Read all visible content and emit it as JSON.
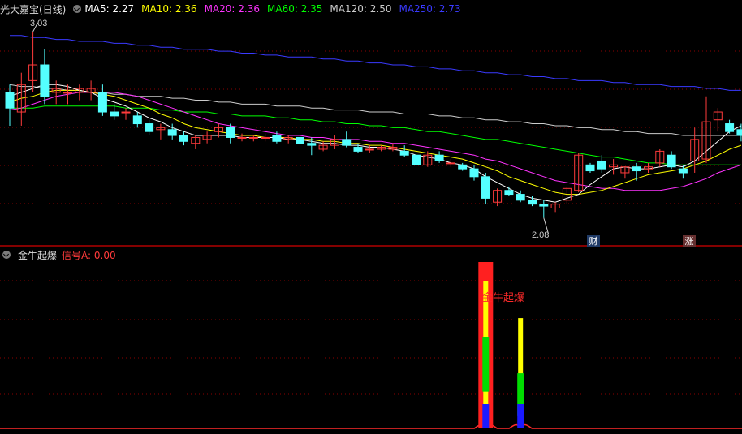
{
  "main_header": {
    "title": "光大嘉宝(日线)",
    "ma": [
      {
        "label": "MA5: 2.27",
        "color": "#ffffff"
      },
      {
        "label": "MA10: 2.36",
        "color": "#ffff00"
      },
      {
        "label": "MA20: 2.36",
        "color": "#ff33ff"
      },
      {
        "label": "MA60: 2.35",
        "color": "#00ff00"
      },
      {
        "label": "MA120: 2.50",
        "color": "#cccccc"
      },
      {
        "label": "MA250: 2.73",
        "color": "#3a3aff"
      }
    ]
  },
  "indicator_header": {
    "title": "金牛起爆",
    "signal_label": "信号A: 0.00"
  },
  "annotations": {
    "high_label": "3.03",
    "low_label": "2.08",
    "event_cai": "财",
    "event_zhang": "涨",
    "signal_text": "金牛起爆"
  },
  "colors": {
    "up": "#ff3b3b",
    "down": "#54ffff",
    "grid": "#8b0000",
    "ma5": "#ffffff",
    "ma10": "#ffff00",
    "ma20": "#ff33ff",
    "ma60": "#00ff00",
    "ma120": "#cccccc",
    "ma250": "#3a3aff"
  },
  "chart_data": {
    "type": "candlestick",
    "y_range": [
      1.95,
      3.1
    ],
    "candles": [
      [
        2.72,
        2.76,
        2.55,
        2.64
      ],
      [
        2.62,
        2.82,
        2.55,
        2.76
      ],
      [
        2.78,
        3.03,
        2.72,
        2.86
      ],
      [
        2.86,
        2.94,
        2.66,
        2.7
      ],
      [
        2.72,
        2.78,
        2.66,
        2.74
      ],
      [
        2.72,
        2.76,
        2.66,
        2.72
      ],
      [
        2.72,
        2.76,
        2.68,
        2.74
      ],
      [
        2.72,
        2.78,
        2.68,
        2.74
      ],
      [
        2.72,
        2.76,
        2.6,
        2.62
      ],
      [
        2.62,
        2.66,
        2.58,
        2.6
      ],
      [
        2.62,
        2.64,
        2.58,
        2.62
      ],
      [
        2.6,
        2.62,
        2.54,
        2.56
      ],
      [
        2.56,
        2.58,
        2.5,
        2.52
      ],
      [
        2.53,
        2.56,
        2.48,
        2.54
      ],
      [
        2.53,
        2.56,
        2.48,
        2.5
      ],
      [
        2.5,
        2.52,
        2.45,
        2.47
      ],
      [
        2.46,
        2.5,
        2.43,
        2.49
      ],
      [
        2.48,
        2.52,
        2.46,
        2.5
      ],
      [
        2.52,
        2.56,
        2.49,
        2.54
      ],
      [
        2.54,
        2.56,
        2.46,
        2.49
      ],
      [
        2.49,
        2.51,
        2.47,
        2.49
      ],
      [
        2.49,
        2.5,
        2.47,
        2.49
      ],
      [
        2.49,
        2.51,
        2.47,
        2.49
      ],
      [
        2.5,
        2.52,
        2.46,
        2.47
      ],
      [
        2.48,
        2.5,
        2.46,
        2.49
      ],
      [
        2.49,
        2.51,
        2.44,
        2.46
      ],
      [
        2.46,
        2.49,
        2.4,
        2.45
      ],
      [
        2.43,
        2.47,
        2.42,
        2.45
      ],
      [
        2.45,
        2.5,
        2.43,
        2.48
      ],
      [
        2.48,
        2.52,
        2.44,
        2.45
      ],
      [
        2.44,
        2.46,
        2.41,
        2.42
      ],
      [
        2.43,
        2.45,
        2.41,
        2.43
      ],
      [
        2.43,
        2.45,
        2.42,
        2.44
      ],
      [
        2.43,
        2.46,
        2.42,
        2.44
      ],
      [
        2.42,
        2.45,
        2.39,
        2.4
      ],
      [
        2.4,
        2.42,
        2.34,
        2.35
      ],
      [
        2.35,
        2.42,
        2.34,
        2.4
      ],
      [
        2.4,
        2.42,
        2.36,
        2.37
      ],
      [
        2.36,
        2.38,
        2.34,
        2.36
      ],
      [
        2.35,
        2.36,
        2.32,
        2.33
      ],
      [
        2.33,
        2.35,
        2.27,
        2.29
      ],
      [
        2.29,
        2.31,
        2.15,
        2.18
      ],
      [
        2.16,
        2.23,
        2.14,
        2.22
      ],
      [
        2.22,
        2.24,
        2.19,
        2.2
      ],
      [
        2.2,
        2.22,
        2.16,
        2.17
      ],
      [
        2.17,
        2.19,
        2.14,
        2.15
      ],
      [
        2.15,
        2.17,
        2.08,
        2.14
      ],
      [
        2.13,
        2.16,
        2.11,
        2.15
      ],
      [
        2.17,
        2.24,
        2.15,
        2.23
      ],
      [
        2.22,
        2.41,
        2.21,
        2.4
      ],
      [
        2.35,
        2.36,
        2.31,
        2.32
      ],
      [
        2.37,
        2.4,
        2.31,
        2.33
      ],
      [
        2.34,
        2.38,
        2.3,
        2.35
      ],
      [
        2.31,
        2.34,
        2.28,
        2.34
      ],
      [
        2.34,
        2.36,
        2.27,
        2.32
      ],
      [
        2.33,
        2.36,
        2.31,
        2.34
      ],
      [
        2.36,
        2.43,
        2.34,
        2.42
      ],
      [
        2.4,
        2.42,
        2.33,
        2.34
      ],
      [
        2.33,
        2.35,
        2.28,
        2.31
      ],
      [
        2.37,
        2.54,
        2.31,
        2.48
      ],
      [
        2.38,
        2.7,
        2.36,
        2.57
      ],
      [
        2.58,
        2.64,
        2.52,
        2.62
      ],
      [
        2.56,
        2.58,
        2.51,
        2.52
      ],
      [
        2.53,
        2.56,
        2.47,
        2.5
      ]
    ],
    "ma5": [
      2.7,
      2.72,
      2.74,
      2.76,
      2.76,
      2.75,
      2.73,
      2.72,
      2.69,
      2.67,
      2.65,
      2.62,
      2.59,
      2.57,
      2.54,
      2.52,
      2.5,
      2.5,
      2.5,
      2.5,
      2.49,
      2.49,
      2.49,
      2.49,
      2.48,
      2.48,
      2.47,
      2.46,
      2.46,
      2.45,
      2.45,
      2.44,
      2.44,
      2.43,
      2.42,
      2.4,
      2.39,
      2.38,
      2.36,
      2.35,
      2.33,
      2.29,
      2.26,
      2.23,
      2.2,
      2.18,
      2.17,
      2.16,
      2.18,
      2.2,
      2.25,
      2.29,
      2.33,
      2.34,
      2.33,
      2.33,
      2.34,
      2.35,
      2.34,
      2.37,
      2.42,
      2.47,
      2.52,
      2.55
    ],
    "ma10": [
      2.67,
      2.69,
      2.7,
      2.72,
      2.73,
      2.73,
      2.73,
      2.72,
      2.71,
      2.7,
      2.68,
      2.66,
      2.64,
      2.61,
      2.59,
      2.56,
      2.54,
      2.53,
      2.52,
      2.51,
      2.5,
      2.5,
      2.49,
      2.49,
      2.49,
      2.48,
      2.48,
      2.47,
      2.47,
      2.46,
      2.46,
      2.45,
      2.45,
      2.44,
      2.43,
      2.42,
      2.41,
      2.4,
      2.39,
      2.38,
      2.36,
      2.34,
      2.32,
      2.29,
      2.27,
      2.25,
      2.23,
      2.21,
      2.2,
      2.2,
      2.21,
      2.22,
      2.24,
      2.26,
      2.28,
      2.3,
      2.31,
      2.32,
      2.33,
      2.35,
      2.37,
      2.4,
      2.43,
      2.45
    ],
    "ma20": [
      2.63,
      2.64,
      2.66,
      2.68,
      2.7,
      2.71,
      2.72,
      2.72,
      2.72,
      2.72,
      2.71,
      2.7,
      2.68,
      2.66,
      2.64,
      2.62,
      2.6,
      2.58,
      2.56,
      2.55,
      2.54,
      2.53,
      2.52,
      2.51,
      2.5,
      2.5,
      2.49,
      2.49,
      2.48,
      2.48,
      2.48,
      2.47,
      2.47,
      2.46,
      2.46,
      2.45,
      2.44,
      2.43,
      2.42,
      2.41,
      2.4,
      2.38,
      2.37,
      2.35,
      2.33,
      2.31,
      2.29,
      2.27,
      2.26,
      2.25,
      2.24,
      2.23,
      2.23,
      2.22,
      2.22,
      2.22,
      2.22,
      2.23,
      2.24,
      2.26,
      2.28,
      2.31,
      2.33,
      2.35
    ],
    "ma60": [
      2.64,
      2.64,
      2.64,
      2.65,
      2.65,
      2.65,
      2.65,
      2.65,
      2.65,
      2.65,
      2.64,
      2.64,
      2.64,
      2.63,
      2.63,
      2.62,
      2.62,
      2.62,
      2.61,
      2.61,
      2.6,
      2.6,
      2.6,
      2.59,
      2.59,
      2.58,
      2.58,
      2.57,
      2.57,
      2.56,
      2.56,
      2.55,
      2.55,
      2.54,
      2.54,
      2.53,
      2.52,
      2.52,
      2.51,
      2.5,
      2.49,
      2.48,
      2.48,
      2.47,
      2.46,
      2.45,
      2.44,
      2.43,
      2.42,
      2.41,
      2.4,
      2.39,
      2.39,
      2.38,
      2.37,
      2.36,
      2.36,
      2.35,
      2.35,
      2.35,
      2.35,
      2.35,
      2.35,
      2.35
    ],
    "ma120": [
      2.76,
      2.75,
      2.75,
      2.74,
      2.74,
      2.73,
      2.73,
      2.72,
      2.72,
      2.71,
      2.71,
      2.7,
      2.7,
      2.7,
      2.69,
      2.69,
      2.68,
      2.68,
      2.67,
      2.67,
      2.66,
      2.66,
      2.66,
      2.65,
      2.65,
      2.65,
      2.64,
      2.64,
      2.63,
      2.63,
      2.63,
      2.62,
      2.62,
      2.62,
      2.61,
      2.61,
      2.61,
      2.6,
      2.6,
      2.59,
      2.59,
      2.58,
      2.58,
      2.57,
      2.57,
      2.56,
      2.56,
      2.55,
      2.55,
      2.54,
      2.54,
      2.53,
      2.53,
      2.52,
      2.52,
      2.51,
      2.51,
      2.51,
      2.5,
      2.5,
      2.5,
      2.5,
      2.5,
      2.5
    ],
    "ma250": [
      3.01,
      3.01,
      3.0,
      3.0,
      2.99,
      2.99,
      2.98,
      2.98,
      2.98,
      2.97,
      2.97,
      2.96,
      2.96,
      2.95,
      2.95,
      2.94,
      2.94,
      2.94,
      2.93,
      2.93,
      2.92,
      2.92,
      2.91,
      2.91,
      2.9,
      2.9,
      2.9,
      2.89,
      2.89,
      2.88,
      2.88,
      2.87,
      2.87,
      2.86,
      2.86,
      2.85,
      2.85,
      2.84,
      2.84,
      2.83,
      2.83,
      2.82,
      2.82,
      2.81,
      2.81,
      2.8,
      2.8,
      2.79,
      2.79,
      2.78,
      2.78,
      2.78,
      2.77,
      2.77,
      2.76,
      2.76,
      2.76,
      2.75,
      2.75,
      2.75,
      2.74,
      2.74,
      2.73,
      2.73
    ],
    "signal_a_bars": [
      {
        "index": 41,
        "strength": 1.0
      },
      {
        "index": 44,
        "strength": 0.78
      }
    ]
  }
}
